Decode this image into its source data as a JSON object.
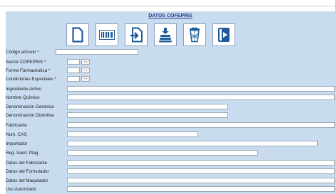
{
  "title": "DATOS COFEPRIS",
  "toolbar": [
    {
      "icon": "new-document-icon"
    },
    {
      "icon": "barcode-icon"
    },
    {
      "icon": "import-icon"
    },
    {
      "icon": "save-stack-icon"
    },
    {
      "icon": "trash-icon"
    },
    {
      "icon": "exit-icon"
    }
  ],
  "fields": {
    "codigo_articulo": {
      "label": "Código artículo *",
      "value": ""
    },
    "sector_cofepris": {
      "label": "Sector COFEPRIS *",
      "value": "",
      "button": "..."
    },
    "forma_farmaceutica": {
      "label": "Forma Farmacéutica *",
      "value": "",
      "button": "..."
    },
    "condiciones_especiales": {
      "label": "Condiciones Especiales *",
      "value": "",
      "button": "..."
    },
    "ingrediente_activo": {
      "label": "Ingrediente Activo",
      "value": ""
    },
    "nombre_quimico": {
      "label": "Nombre Químico",
      "value": ""
    },
    "denominacion_generica": {
      "label": "Denominación Genérica",
      "value": ""
    },
    "denominacion_distintiva": {
      "label": "Denominación Distintiva",
      "value": ""
    },
    "fabricante": {
      "label": "Fabricante",
      "value": ""
    },
    "num_cas": {
      "label": "Num. CAS",
      "value": ""
    },
    "importador": {
      "label": "Importador",
      "value": ""
    },
    "reg_sanit_plag": {
      "label": "Reg. Sanit. Plag.",
      "value": ""
    },
    "datos_fabricante": {
      "label": "Datos del Fabricante",
      "value": ""
    },
    "datos_formulador": {
      "label": "Datos del Formulador",
      "value": ""
    },
    "datos_maquilador": {
      "label": "Datos del Maquilador",
      "value": ""
    },
    "uso_autorizado": {
      "label": "Uso Autorizado",
      "value": ""
    }
  }
}
